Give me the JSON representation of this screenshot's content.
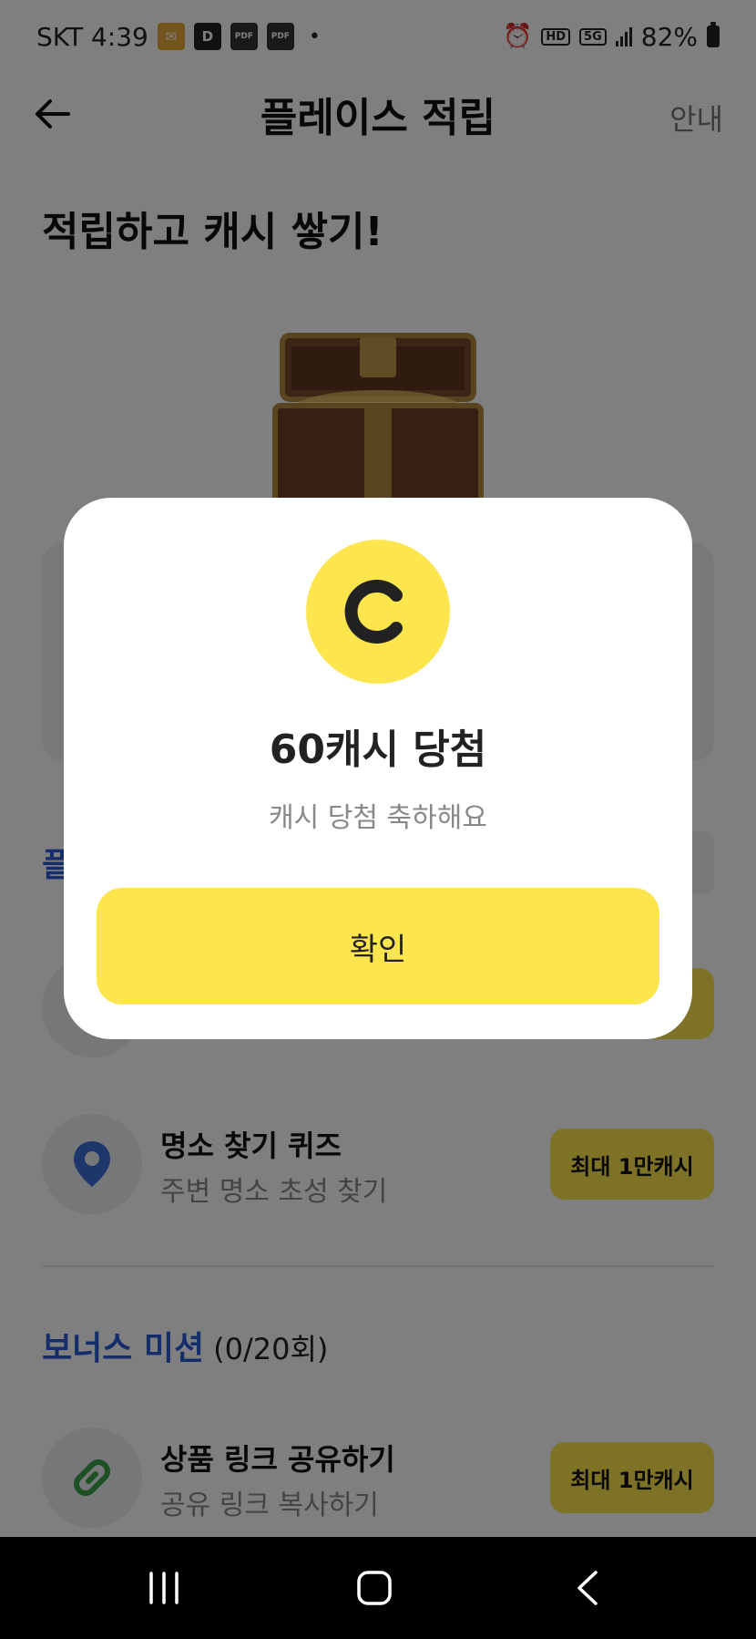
{
  "status_bar": {
    "carrier_time": "SKT 4:39",
    "notif_d": "D",
    "pdf_label": "PDF",
    "dot": "•",
    "hd_voice": "HD",
    "net_5g": "5G",
    "battery": "82%"
  },
  "header": {
    "title": "플레이스 적립",
    "guide": "안내"
  },
  "hero": {
    "title": "적립하고 캐시 쌓기!"
  },
  "missions": [
    {
      "title": "명소 찾기 퀴즈",
      "subtitle": "주변 명소 초성 찾기",
      "reward": "최대 1만캐시"
    },
    {
      "title": "상품 링크 공유하기",
      "subtitle": "공유 링크 복사하기",
      "reward": "최대 1만캐시"
    }
  ],
  "bonus": {
    "title": "보너스 미션",
    "count": "(0/20회)"
  },
  "modal": {
    "coin_letter": "C",
    "title": "60캐시 당첨",
    "subtitle": "캐시 당첨 축하해요",
    "confirm": "확인"
  },
  "colors": {
    "accent_yellow": "#fde54d",
    "accent_blue": "#2a5bd7",
    "dim": "rgba(0,0,0,0.5)"
  }
}
